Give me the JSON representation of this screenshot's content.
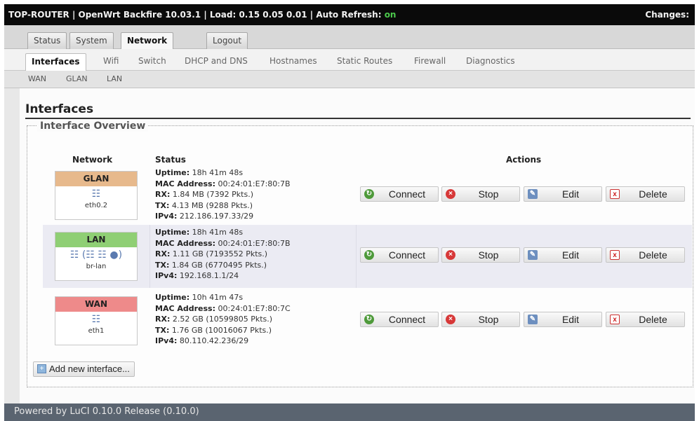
{
  "header": {
    "system": "TOP-ROUTER | OpenWrt Backfire 10.03.1 | Load: 0.15 0.05 0.01 | Auto Refresh: ",
    "refresh_state": "on",
    "changes": "Changes:"
  },
  "main_tabs": [
    {
      "label": "Status"
    },
    {
      "label": "System"
    },
    {
      "label": "Network"
    },
    {
      "label": "Logout"
    }
  ],
  "sub_tabs": [
    {
      "label": "Interfaces"
    },
    {
      "label": "Wifi"
    },
    {
      "label": "Switch"
    },
    {
      "label": "DHCP and DNS"
    },
    {
      "label": "Hostnames"
    },
    {
      "label": "Static Routes"
    },
    {
      "label": "Firewall"
    },
    {
      "label": "Diagnostics"
    }
  ],
  "iface_tabs": [
    {
      "label": "WAN"
    },
    {
      "label": "GLAN"
    },
    {
      "label": "LAN"
    }
  ],
  "page_title": "Interfaces",
  "overview": {
    "legend": "Interface Overview",
    "col_network": "Network",
    "col_status": "Status",
    "col_actions": "Actions",
    "rows": [
      {
        "name": "GLAN",
        "color": "#e7b98c",
        "device": "eth0.2",
        "icon": "ethernet-icon",
        "uptime": "18h 41m 48s",
        "mac": "00:24:01:E7:80:7B",
        "rx": "1.84 MB (7392 Pkts.)",
        "tx": "4.13 MB (9288 Pkts.)",
        "ipv4": "212.186.197.33/29"
      },
      {
        "name": "LAN",
        "color": "#8fcf74",
        "device": "br-lan",
        "icon": "bridge-icon",
        "uptime": "18h 41m 48s",
        "mac": "00:24:01:E7:80:7B",
        "rx": "1.11 GB (7193552 Pkts.)",
        "tx": "1.84 GB (6770495 Pkts.)",
        "ipv4": "192.168.1.1/24"
      },
      {
        "name": "WAN",
        "color": "#ee8a8a",
        "device": "eth1",
        "icon": "ethernet-icon",
        "uptime": "10h 41m 47s",
        "mac": "00:24:01:E7:80:7C",
        "rx": "2.52 GB (10599805 Pkts.)",
        "tx": "1.76 GB (10016067 Pkts.)",
        "ipv4": "80.110.42.236/29"
      }
    ],
    "labels": {
      "uptime": "Uptime:",
      "mac": "MAC Address:",
      "rx": "RX:",
      "tx": "TX:",
      "ipv4": "IPv4:"
    },
    "actions": {
      "connect": "Connect",
      "stop": "Stop",
      "edit": "Edit",
      "delete": "Delete"
    },
    "add_label": "Add new interface..."
  },
  "footer": "Powered by LuCI 0.10.0 Release (0.10.0)"
}
